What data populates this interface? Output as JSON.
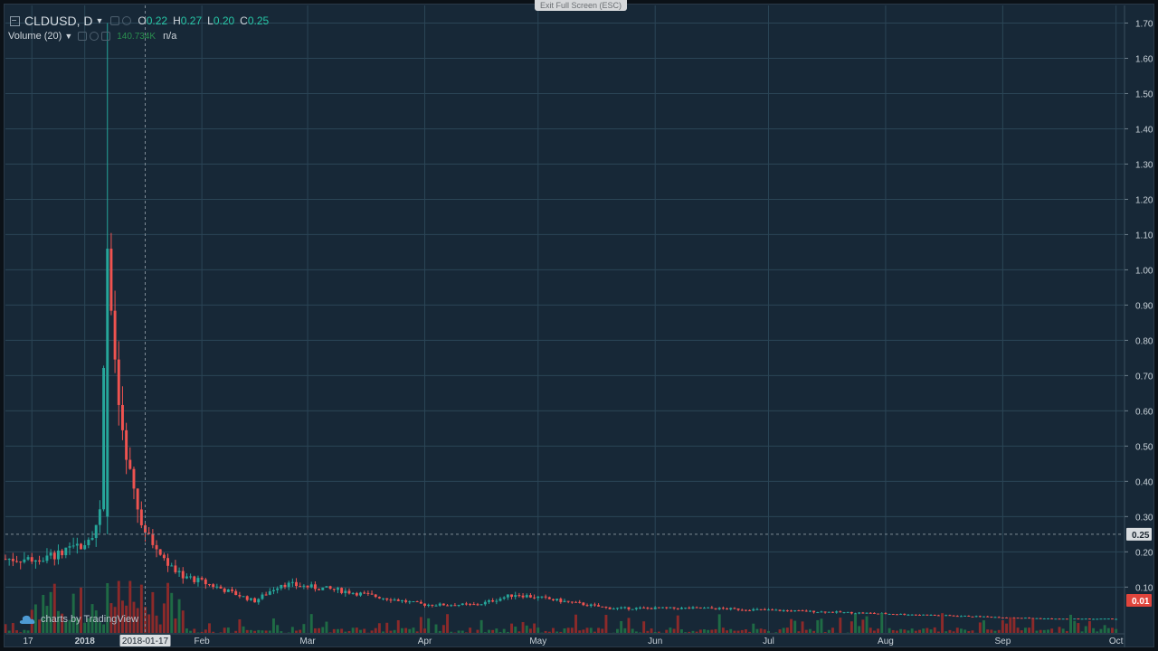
{
  "window": {
    "exit_fullscreen": "Exit Full Screen (ESC)"
  },
  "header": {
    "symbol": "CLDUSD, D",
    "ohlc": {
      "o_label": "O",
      "o": "0.22",
      "h_label": "H",
      "h": "0.27",
      "l_label": "L",
      "l": "0.20",
      "c_label": "C",
      "c": "0.25"
    }
  },
  "volume_legend": {
    "label": "Volume (20)",
    "value": "140.734K",
    "ma": "n/a"
  },
  "watermark": "charts by TradingView",
  "colors": {
    "background": "#172837",
    "grid": "#2b4556",
    "up": "#26a69a",
    "down": "#ef5350",
    "volume_up": "#1f6b45",
    "volume_down": "#8c2a2a"
  },
  "chart_data": {
    "type": "candlestick",
    "title": "CLDUSD, D",
    "x_start": "2017-12-11",
    "x_end": "2018-10-03",
    "x_ticks": [
      "17",
      "2018",
      "Feb",
      "Mar",
      "Apr",
      "May",
      "Jun",
      "Jul",
      "Aug",
      "Sep",
      "Oct"
    ],
    "crosshair_x_label": "2018-01-17",
    "y_ticks": [
      "0.10",
      "0.20",
      "0.30",
      "0.40",
      "0.50",
      "0.60",
      "0.70",
      "0.80",
      "0.90",
      "1.00",
      "1.10",
      "1.20",
      "1.30",
      "1.40",
      "1.50",
      "1.60",
      "1.70"
    ],
    "ylim": [
      -0.03,
      1.75
    ],
    "last_price_label": "0.25",
    "last_price": 0.25,
    "low_marker_label": "0.01",
    "grid": true,
    "close_series_approx": [
      {
        "date": "2017-12-11",
        "close": 0.18
      },
      {
        "date": "2017-12-20",
        "close": 0.18
      },
      {
        "date": "2017-12-28",
        "close": 0.2
      },
      {
        "date": "2018-01-02",
        "close": 0.24
      },
      {
        "date": "2018-01-05",
        "close": 0.3
      },
      {
        "date": "2018-01-07",
        "close": 1.06
      },
      {
        "date": "2018-01-09",
        "close": 0.7
      },
      {
        "date": "2018-01-12",
        "close": 0.45
      },
      {
        "date": "2018-01-17",
        "close": 0.25
      },
      {
        "date": "2018-01-25",
        "close": 0.14
      },
      {
        "date": "2018-02-05",
        "close": 0.1
      },
      {
        "date": "2018-02-15",
        "close": 0.06
      },
      {
        "date": "2018-02-22",
        "close": 0.11
      },
      {
        "date": "2018-03-10",
        "close": 0.09
      },
      {
        "date": "2018-04-01",
        "close": 0.05
      },
      {
        "date": "2018-04-15",
        "close": 0.05
      },
      {
        "date": "2018-04-25",
        "close": 0.08
      },
      {
        "date": "2018-05-20",
        "close": 0.04
      },
      {
        "date": "2018-06-15",
        "close": 0.04
      },
      {
        "date": "2018-07-15",
        "close": 0.03
      },
      {
        "date": "2018-08-15",
        "close": 0.02
      },
      {
        "date": "2018-09-15",
        "close": 0.01
      },
      {
        "date": "2018-10-01",
        "close": 0.01
      }
    ],
    "volume_series_approx": [
      {
        "date": "2018-01-07",
        "volume": 140734
      },
      {
        "date": "2018-01-13",
        "volume": 60000
      },
      {
        "date": "2018-01-21",
        "volume": 40000
      }
    ]
  }
}
